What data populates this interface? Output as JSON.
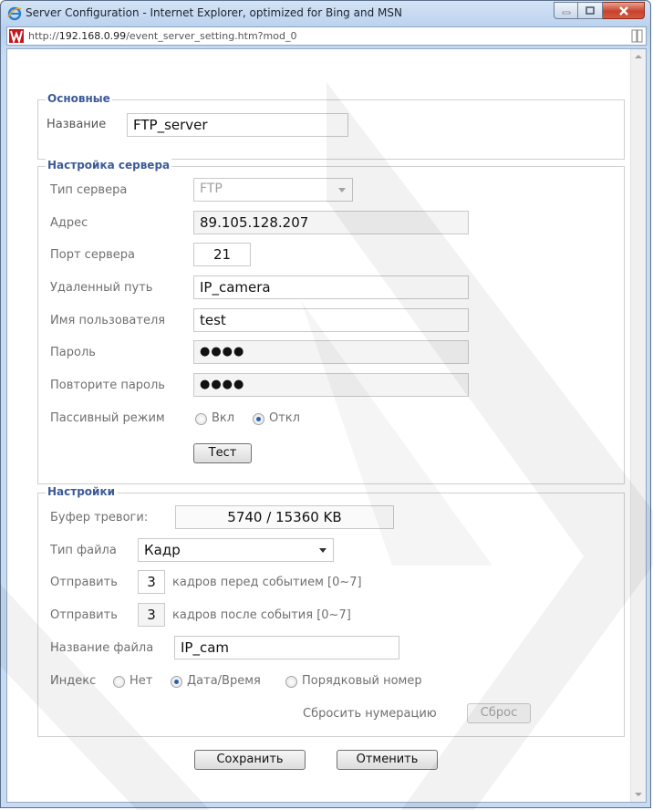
{
  "window": {
    "title": "Server Configuration - Internet Explorer, optimized for Bing and MSN",
    "url_prefix": "http://",
    "url_host": "192.168.0.99",
    "url_path": "/event_server_setting.htm?mod_0"
  },
  "basic": {
    "legend": "Основные",
    "name_label": "Название",
    "name_value": "FTP_server"
  },
  "server": {
    "legend": "Настройка сервера",
    "type_label": "Тип сервера",
    "type_value": "FTP",
    "address_label": "Адрес",
    "address_value": "89.105.128.207",
    "port_label": "Порт сервера",
    "port_value": "21",
    "path_label": "Удаленный путь",
    "path_value": "IP_camera",
    "user_label": "Имя пользователя",
    "user_value": "test",
    "password_label": "Пароль",
    "password_value": "●●●●",
    "repeat_label": "Повторите пароль",
    "repeat_value": "●●●●",
    "passive_label": "Пассивный режим",
    "passive_on": "Вкл",
    "passive_off": "Откл",
    "passive_selected": "off",
    "test_button": "Тест"
  },
  "settings": {
    "legend": "Настройки",
    "buffer_label": "Буфер тревоги:",
    "buffer_value": "5740 / 15360 KB",
    "filetype_label": "Тип файла",
    "filetype_value": "Кадр",
    "send_label_1": "Отправить",
    "pre_frames": "3",
    "pre_suffix": "кадров перед событием [0~7]",
    "send_label_2": "Отправить",
    "post_frames": "3",
    "post_suffix": "кадров после события [0~7]",
    "filename_label": "Название файла",
    "filename_value": "IP_cam",
    "index_label": "Индекс",
    "index_none": "Нет",
    "index_datetime": "Дата/Время",
    "index_serial": "Порядковый номер",
    "index_selected": "datetime",
    "reset_label": "Сбросить нумерацию",
    "reset_button": "Сброс"
  },
  "footer": {
    "save_button": "Сохранить",
    "cancel_button": "Отменить"
  },
  "colors": {
    "legend": "#3c5a99",
    "radio_dot": "#2b5fb3"
  }
}
